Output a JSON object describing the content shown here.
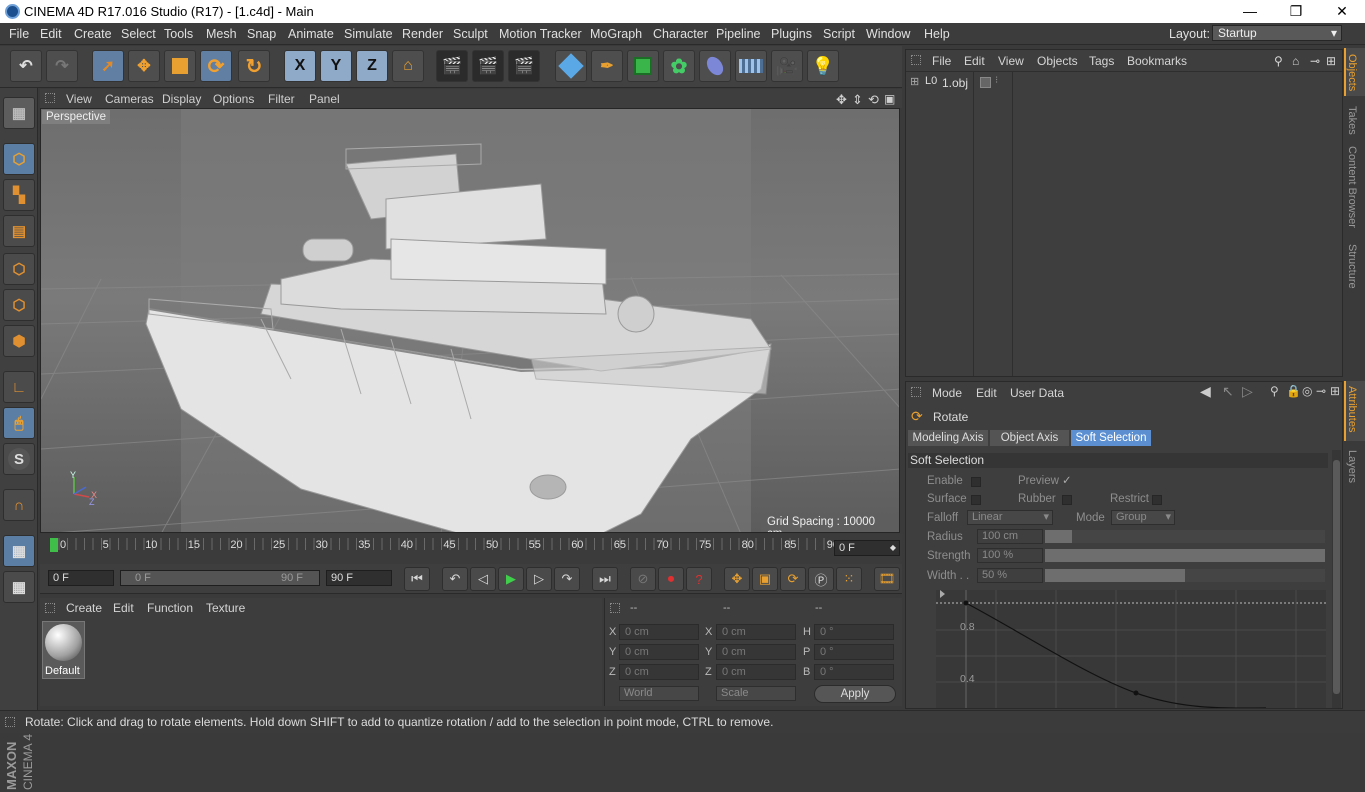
{
  "window": {
    "title": "CINEMA 4D R17.016 Studio (R17) - [1.c4d] - Main",
    "minimize": "—",
    "restore": "❐",
    "close": "✕"
  },
  "menu": [
    "File",
    "Edit",
    "Create",
    "Select",
    "Tools",
    "Mesh",
    "Snap",
    "Animate",
    "Simulate",
    "Render",
    "Sculpt",
    "Motion Tracker",
    "MoGraph",
    "Character",
    "Pipeline",
    "Plugins",
    "Script",
    "Window",
    "Help"
  ],
  "layout": {
    "label": "Layout:",
    "value": "Startup"
  },
  "toolbar": {
    "undo": "↶",
    "redo": "↷",
    "x": "X",
    "y": "Y",
    "z": "Z"
  },
  "viewport": {
    "menu": [
      "View",
      "Cameras",
      "Display",
      "Options",
      "Filter",
      "Panel"
    ],
    "label": "Perspective",
    "grid_spacing": "Grid Spacing : 10000 cm",
    "axis_y": "Y",
    "axis_x": "X",
    "axis_z": "Z"
  },
  "timeline": {
    "ticks": [
      "0",
      "5",
      "10",
      "15",
      "20",
      "25",
      "30",
      "35",
      "40",
      "45",
      "50",
      "55",
      "60",
      "65",
      "70",
      "75",
      "80",
      "85",
      "90"
    ],
    "current_frame": "0 F"
  },
  "transport": {
    "start": "0 F",
    "range_start": "0 F",
    "range_end": "90 F",
    "end": "90 F"
  },
  "materials": {
    "menu": [
      "Create",
      "Edit",
      "Function",
      "Texture"
    ],
    "item": "Default"
  },
  "coords": {
    "header": [
      "--",
      "--",
      "--"
    ],
    "rows": [
      {
        "l1": "X",
        "v1": "0 cm",
        "l2": "X",
        "v2": "0 cm",
        "l3": "H",
        "v3": "0 °"
      },
      {
        "l1": "Y",
        "v1": "0 cm",
        "l2": "Y",
        "v2": "0 cm",
        "l3": "P",
        "v3": "0 °"
      },
      {
        "l1": "Z",
        "v1": "0 cm",
        "l2": "Z",
        "v2": "0 cm",
        "l3": "B",
        "v3": "0 °"
      }
    ],
    "space": "World",
    "mode": "Scale",
    "apply": "Apply"
  },
  "objects": {
    "menu": [
      "File",
      "Edit",
      "View",
      "Objects",
      "Tags",
      "Bookmarks"
    ],
    "item": "1.obj"
  },
  "attributes": {
    "menu": [
      "Mode",
      "Edit",
      "User Data"
    ],
    "tool": "Rotate",
    "tabs": [
      "Modeling Axis",
      "Object Axis",
      "Soft Selection"
    ],
    "section": "Soft Selection",
    "enable": "Enable",
    "preview": "Preview",
    "preview_check": "✓",
    "surface": "Surface",
    "rubber": "Rubber",
    "restrict": "Restrict",
    "falloff_label": "Falloff",
    "falloff": "Linear",
    "mode_label": "Mode",
    "mode": "Group",
    "radius_label": "Radius",
    "radius": "100 cm",
    "strength_label": "Strength",
    "strength": "100 %",
    "width_label": "Width . .",
    "width": "50 %",
    "width_fill": 0.5,
    "graph_08": "0.8",
    "graph_04": "0.4"
  },
  "right_tabs": [
    "Objects",
    "Takes",
    "Content Browser",
    "Structure",
    "Attributes",
    "Layers"
  ],
  "status": "Rotate: Click and drag to rotate elements. Hold down SHIFT to add to quantize rotation / add to the selection in point mode, CTRL to remove."
}
